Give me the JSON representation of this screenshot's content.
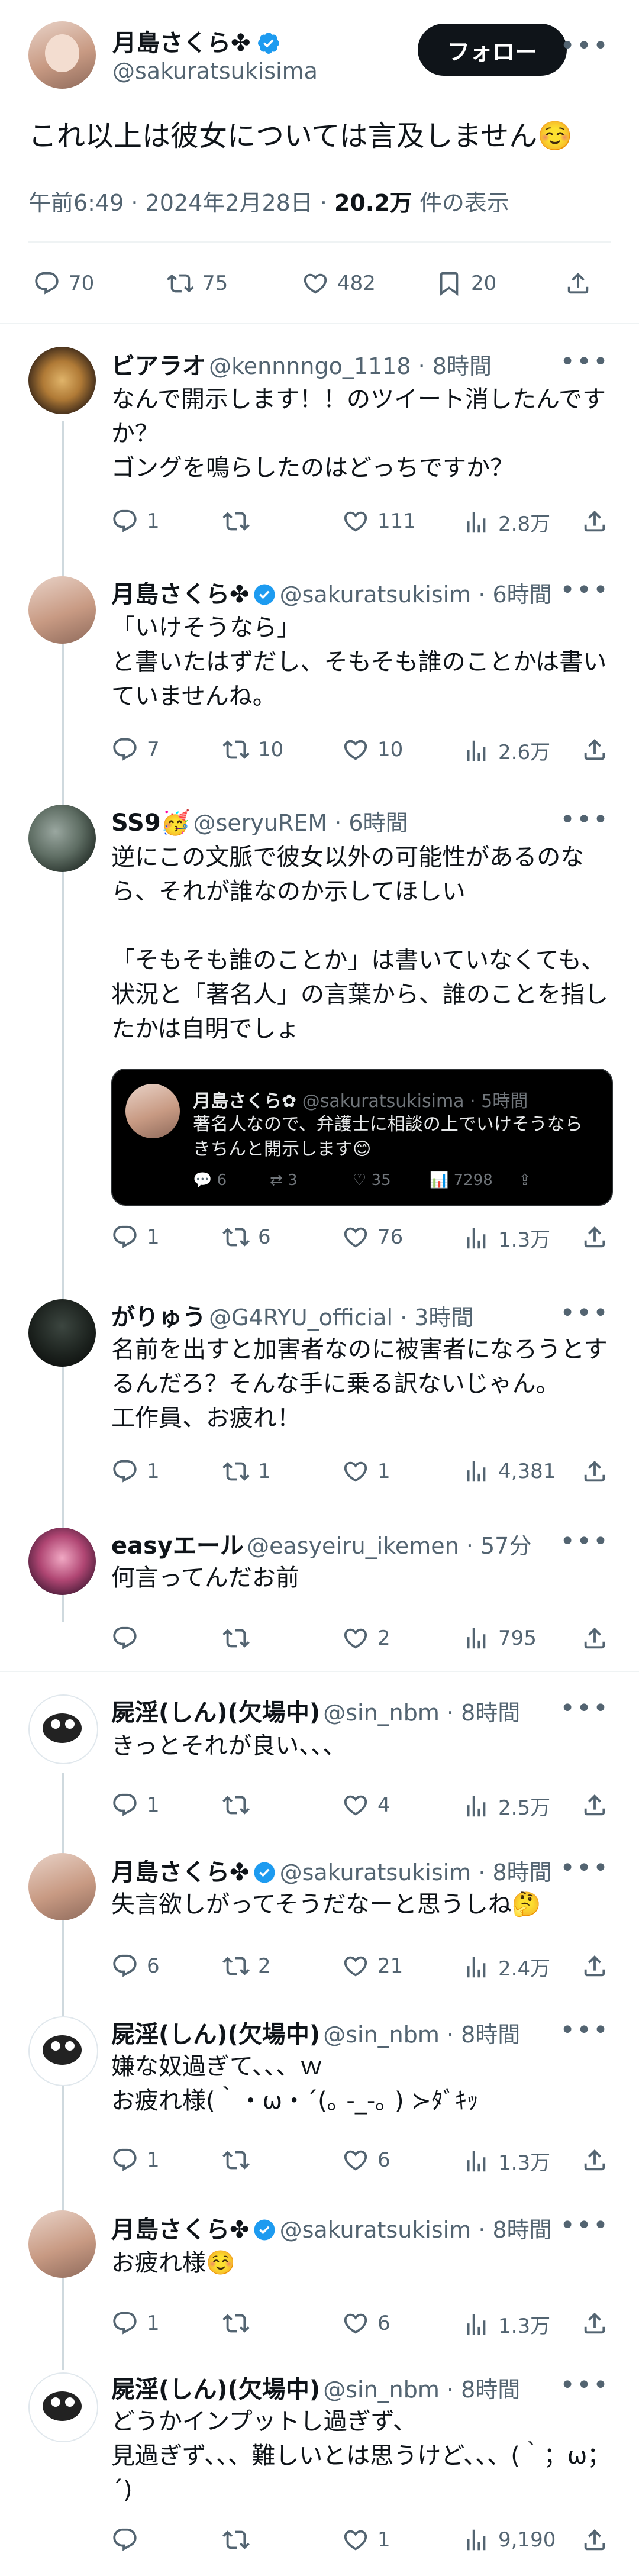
{
  "header": {
    "name": "月島さくら✤",
    "handle": "@sakuratsukisima",
    "follow_label": "フォロー",
    "text": "これ以上は彼女については言及しません☺️",
    "meta_time": "午前6:49 · 2024年2月28日 · ",
    "views_count": "20.2万",
    "views_suffix": " 件の表示",
    "counts": {
      "replies": "70",
      "reposts": "75",
      "likes": "482",
      "bookmarks": "20"
    }
  },
  "replies": [
    {
      "name": "ビアラオ",
      "handle": "@kennnngo_1118 · 8時間",
      "text": "なんで開示します！！のツイート消したんですか？\nゴングを鳴らしたのはどっちですか？",
      "reply": "1",
      "repost": "",
      "like": "111",
      "views": "2.8万"
    },
    {
      "name": "月島さくら✤",
      "handle": "@sakuratsukisim · 6時間",
      "text": "「いけそうなら」\nと書いたはずだし、そもそも誰のことかは書いていませんね。",
      "reply": "7",
      "repost": "10",
      "like": "10",
      "views": "2.6万"
    },
    {
      "name": "SS9🥳",
      "handle": "@seryuREM · 6時間",
      "text": "逆にこの文脈で彼女以外の可能性があるのなら、それが誰なのか示してほしい\n\n「そもそも誰のことか」は書いていなくても、状況と「著名人」の言葉から、誰のことを指したかは自明でしょ",
      "quote": {
        "name": "月島さくら✿",
        "handle": "@sakuratsukisima · 5時間",
        "text": "著名人なので、弁護士に相談の上でいけそうならきちんと開示します😊",
        "reply": "6",
        "repost": "3",
        "like": "35",
        "views": "7298"
      },
      "reply": "1",
      "repost": "6",
      "like": "76",
      "views": "1.3万"
    },
    {
      "name": "がりゅう",
      "handle": "@G4RYU_official · 3時間",
      "text": "名前を出すと加害者なのに被害者になろうとするんだろ？そんな手に乗る訳ないじゃん。\n工作員、お疲れ！",
      "reply": "1",
      "repost": "1",
      "like": "1",
      "views": "4,381"
    },
    {
      "name": "easyエール",
      "handle": "@easyeiru_ikemen · 57分",
      "text": "何言ってんだお前",
      "reply": "",
      "repost": "",
      "like": "2",
      "views": "795"
    },
    {
      "name": "屍淫(しん)(欠場中)",
      "handle": "@sin_nbm · 8時間",
      "text": "きっとそれが良い、、、",
      "reply": "1",
      "repost": "",
      "like": "4",
      "views": "2.5万"
    },
    {
      "name": "月島さくら✤",
      "handle": "@sakuratsukisim · 8時間",
      "text": "失言欲しがってそうだなーと思うしね🤔",
      "reply": "6",
      "repost": "2",
      "like": "21",
      "views": "2.4万"
    },
    {
      "name": "屍淫(しん)(欠場中)",
      "handle": "@sin_nbm · 8時間",
      "text": "嫌な奴過ぎて、、、ｗ\nお疲れ様(｀・ω・´(｡ -_-｡ ) ≻ﾀﾞｷｯ",
      "reply": "1",
      "repost": "",
      "like": "6",
      "views": "1.3万"
    },
    {
      "name": "月島さくら✤",
      "handle": "@sakuratsukisim · 8時間",
      "text": "お疲れ様☺️",
      "reply": "1",
      "repost": "",
      "like": "6",
      "views": "1.3万"
    },
    {
      "name": "屍淫(しん)(欠場中)",
      "handle": "@sin_nbm · 8時間",
      "text": "どうかインプットし過ぎず、\n見過ぎず、、、難しいとは思うけど、、、(｀；ω；´)",
      "reply": "",
      "repost": "",
      "like": "1",
      "views": "9,190"
    }
  ],
  "colors": {
    "accent": "#1d9bf0",
    "text": "#0f1419",
    "muted": "#536471",
    "divider": "#eff3f4"
  }
}
